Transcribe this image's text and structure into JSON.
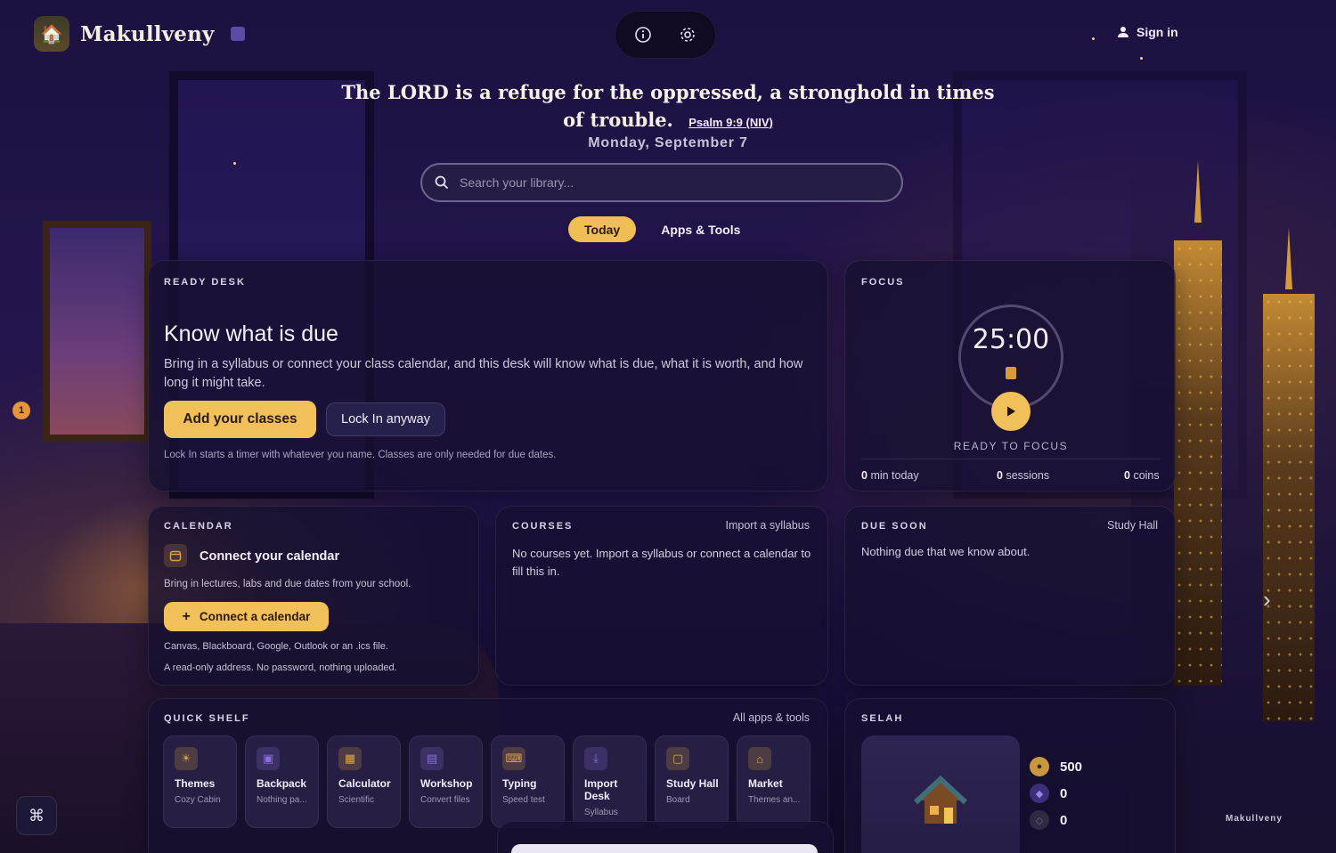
{
  "brand": {
    "name": "Makullveny",
    "logo_icon": "cabin-icon"
  },
  "header": {
    "info_icon": "info-icon",
    "settings_icon": "gear-icon",
    "signin_label": "Sign in"
  },
  "verse": {
    "text": "The LORD is a refuge for the oppressed, a stronghold in times of trouble.",
    "reference": "Psalm 9:9 (NIV)"
  },
  "date": "Monday, September 7",
  "search": {
    "placeholder": "Search your library..."
  },
  "tabs": [
    {
      "label": "Today",
      "active": true
    },
    {
      "label": "Apps & Tools",
      "active": false
    }
  ],
  "ready_desk": {
    "label": "READY DESK",
    "title": "Know what is due",
    "body": "Bring in a syllabus or connect your class calendar, and this desk will know what is due, what it is worth, and how long it might take.",
    "primary_button": "Add your classes",
    "secondary_button": "Lock In anyway",
    "note": "Lock In starts a timer with whatever you name. Classes are only needed for due dates."
  },
  "focus": {
    "label": "FOCUS",
    "timer": "25:00",
    "status": "READY TO FOCUS",
    "stats": [
      {
        "value": "0",
        "unit": "min today"
      },
      {
        "value": "0",
        "unit": "sessions"
      },
      {
        "value": "0",
        "unit": "coins"
      }
    ]
  },
  "calendar": {
    "label": "CALENDAR",
    "title": "Connect your calendar",
    "body": "Bring in lectures, labs and due dates from your school.",
    "button": "Connect a calendar",
    "note1": "Canvas, Blackboard, Google, Outlook or an .ics file.",
    "note2": "A read-only address. No password, nothing uploaded."
  },
  "courses": {
    "label": "COURSES",
    "link": "Import a syllabus",
    "body": "No courses yet. Import a syllabus or connect a calendar to fill this in."
  },
  "due_soon": {
    "label": "DUE SOON",
    "link": "Study Hall",
    "body": "Nothing due that we know about."
  },
  "quick_shelf": {
    "label": "QUICK SHELF",
    "link": "All apps & tools",
    "items": [
      {
        "title": "Themes",
        "sub": "Cozy Cabin",
        "icon": "sun-icon",
        "color": "#d9a347"
      },
      {
        "title": "Backpack",
        "sub": "Nothing pa...",
        "icon": "backpack-icon",
        "color": "#8a6ee0"
      },
      {
        "title": "Calculator",
        "sub": "Scientific",
        "icon": "calculator-icon",
        "color": "#d9a347"
      },
      {
        "title": "Workshop",
        "sub": "Convert files",
        "icon": "file-icon",
        "color": "#8a6ee0"
      },
      {
        "title": "Typing",
        "sub": "Speed test",
        "icon": "keyboard-icon",
        "color": "#d9a347"
      },
      {
        "title": "Import Desk",
        "sub": "Syllabus",
        "icon": "download-icon",
        "color": "#8a6ee0"
      },
      {
        "title": "Study Hall",
        "sub": "Board",
        "icon": "board-icon",
        "color": "#d9a347"
      },
      {
        "title": "Market",
        "sub": "Themes an...",
        "icon": "store-icon",
        "color": "#d9a347"
      }
    ]
  },
  "selah": {
    "label": "SELAH",
    "counters": [
      {
        "value": "500",
        "icon": "coin-icon",
        "color": "#c9973d"
      },
      {
        "value": "0",
        "icon": "gem-icon",
        "color": "#7b5fd6"
      },
      {
        "value": "0",
        "icon": "shard-icon",
        "color": "#4a4260"
      }
    ]
  },
  "footer": {
    "brand": "Makullveny",
    "badge": "1"
  },
  "colors": {
    "accent": "#f2c05a",
    "background": "#1c1140",
    "card": "#160f30"
  }
}
